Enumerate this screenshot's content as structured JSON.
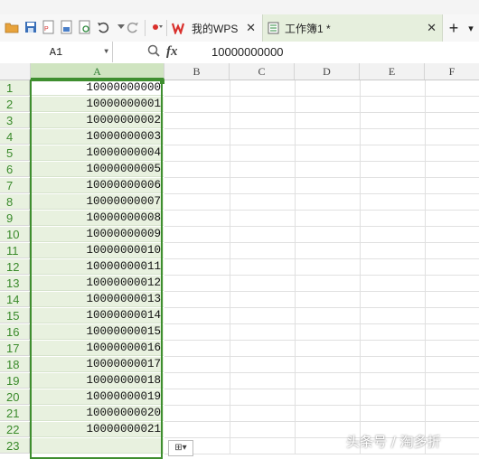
{
  "toolbar": {
    "tabs": [
      {
        "label": "我的WPS",
        "active": false
      },
      {
        "label": "工作簿1 *",
        "active": true
      }
    ],
    "new_tab": "+",
    "dropdown": "▾"
  },
  "formula_bar": {
    "name_box": "A1",
    "fx_label": "fx",
    "value": "10000000000"
  },
  "columns": [
    "A",
    "B",
    "C",
    "D",
    "E",
    "F"
  ],
  "rows": [
    {
      "num": "1",
      "a": "10000000000"
    },
    {
      "num": "2",
      "a": "10000000001"
    },
    {
      "num": "3",
      "a": "10000000002"
    },
    {
      "num": "4",
      "a": "10000000003"
    },
    {
      "num": "5",
      "a": "10000000004"
    },
    {
      "num": "6",
      "a": "10000000005"
    },
    {
      "num": "7",
      "a": "10000000006"
    },
    {
      "num": "8",
      "a": "10000000007"
    },
    {
      "num": "9",
      "a": "10000000008"
    },
    {
      "num": "10",
      "a": "10000000009"
    },
    {
      "num": "11",
      "a": "10000000010"
    },
    {
      "num": "12",
      "a": "10000000011"
    },
    {
      "num": "13",
      "a": "10000000012"
    },
    {
      "num": "14",
      "a": "10000000013"
    },
    {
      "num": "15",
      "a": "10000000014"
    },
    {
      "num": "16",
      "a": "10000000015"
    },
    {
      "num": "17",
      "a": "10000000016"
    },
    {
      "num": "18",
      "a": "10000000017"
    },
    {
      "num": "19",
      "a": "10000000018"
    },
    {
      "num": "20",
      "a": "10000000019"
    },
    {
      "num": "21",
      "a": "10000000020"
    },
    {
      "num": "22",
      "a": "10000000021"
    },
    {
      "num": "23",
      "a": ""
    }
  ],
  "watermark": "头条号 / 淘多折",
  "colors": {
    "selection": "#3e8e2f",
    "selection_fill": "#e8f1df",
    "wps_red": "#d9302c"
  }
}
